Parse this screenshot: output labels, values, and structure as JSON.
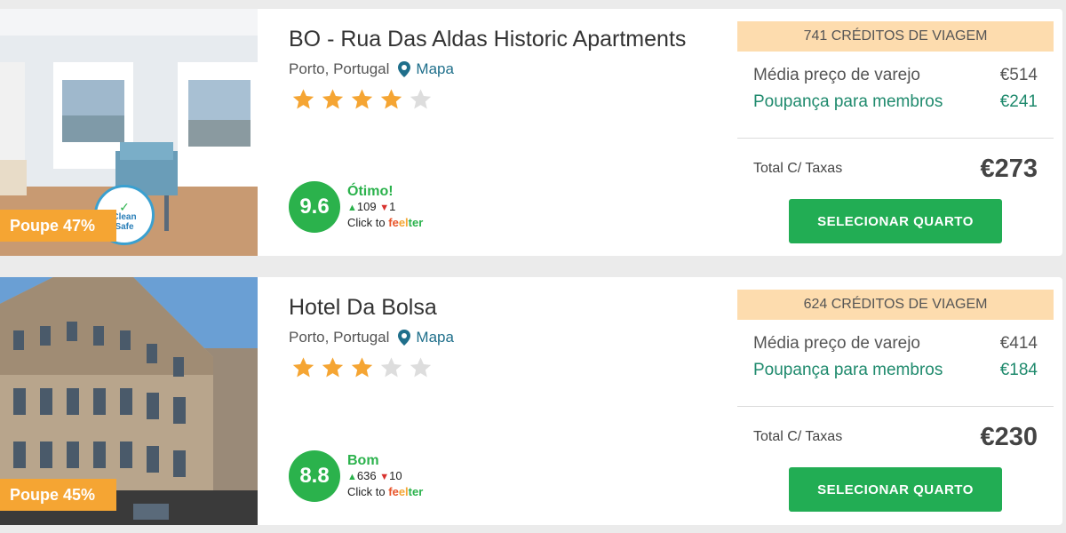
{
  "hotels": [
    {
      "name": "BO - Rua Das Aldas Historic Apartments",
      "location": "Porto, Portugal",
      "map_label": "Mapa",
      "stars": 4,
      "max_stars": 5,
      "save_badge": "Poupe 47%",
      "clean_badge": {
        "line1": "Clean",
        "line2": "Safe"
      },
      "score": "9.6",
      "score_label": "Ótimo!",
      "votes_up": "109",
      "votes_down": "1",
      "click_to": "Click to",
      "feelter": "feelter",
      "credits": "741 CRÉDITOS DE VIAGEM",
      "retail_label": "Média preço de varejo",
      "retail_value": "€514",
      "savings_label": "Poupança para membros",
      "savings_value": "€241",
      "total_label": "Total C/ Taxas",
      "total_value": "€273",
      "select_label": "SELECIONAR QUARTO"
    },
    {
      "name": "Hotel Da Bolsa",
      "location": "Porto, Portugal",
      "map_label": "Mapa",
      "stars": 3,
      "max_stars": 5,
      "save_badge": "Poupe 45%",
      "score": "8.8",
      "score_label": "Bom",
      "votes_up": "636",
      "votes_down": "10",
      "click_to": "Click to",
      "feelter": "feelter",
      "credits": "624 CRÉDITOS DE VIAGEM",
      "retail_label": "Média preço de varejo",
      "retail_value": "€414",
      "savings_label": "Poupança para membros",
      "savings_value": "€184",
      "total_label": "Total C/ Taxas",
      "total_value": "€230",
      "select_label": "SELECIONAR QUARTO"
    }
  ],
  "colors": {
    "accent_green": "#22ad54",
    "score_green": "#2bb24c",
    "savings_green": "#1f8a6d",
    "badge_orange": "#f5a533",
    "credits_bg": "#fddcae",
    "star_filled": "#f5a533",
    "star_empty": "#dddddd",
    "map_link": "#1f6f8b"
  },
  "icons": {
    "map": "map-pin-icon",
    "star": "star-icon",
    "up": "triangle-up-icon",
    "down": "triangle-down-icon"
  }
}
